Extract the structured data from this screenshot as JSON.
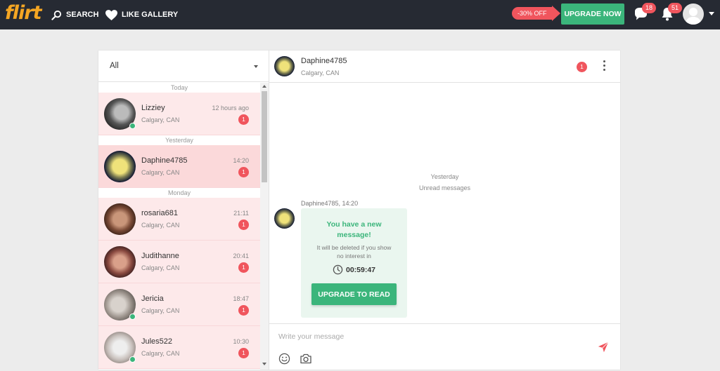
{
  "app": {
    "logo_text": "flirt"
  },
  "nav": {
    "search_label": "SEARCH",
    "like_gallery_label": "LIKE GALLERY"
  },
  "promo": {
    "discount": "-30% OFF",
    "upgrade_label": "UPGRADE NOW"
  },
  "notifications": {
    "messages_count": "18",
    "alerts_count": "51"
  },
  "colors": {
    "accent_green": "#3bb57b",
    "badge_red": "#f0555d",
    "topbar": "#262a33",
    "logo": "#f5a623"
  },
  "filter": {
    "selected": "All"
  },
  "conversations": {
    "sep_today": "Today",
    "sep_yesterday": "Yesterday",
    "sep_monday": "Monday",
    "items": [
      {
        "name": "Lizziey",
        "location": "Calgary, CAN",
        "time": "12 hours ago",
        "unread": "1"
      },
      {
        "name": "Daphine4785",
        "location": "Calgary, CAN",
        "time": "14:20",
        "unread": "1"
      },
      {
        "name": "rosaria681",
        "location": "Calgary, CAN",
        "time": "21:11",
        "unread": "1"
      },
      {
        "name": "Judithanne",
        "location": "Calgary, CAN",
        "time": "20:41",
        "unread": "1"
      },
      {
        "name": "Jericia",
        "location": "Calgary, CAN",
        "time": "18:47",
        "unread": "1"
      },
      {
        "name": "Jules522",
        "location": "Calgary, CAN",
        "time": "10:30",
        "unread": "1"
      }
    ]
  },
  "chat": {
    "name": "Daphine4785",
    "location": "Calgary, CAN",
    "unread": "1",
    "date_sep": "Yesterday",
    "unread_label": "Unread messages",
    "msg_meta": "Daphine4785,  14:20",
    "card_title_line1": "You have a new",
    "card_title_line2": "message!",
    "card_sub_line1": "It will be deleted if you show",
    "card_sub_line2": "no interest in",
    "timer": "00:59:47",
    "upgrade_read_label": "UPGRADE TO READ",
    "input_placeholder": "Write your message"
  }
}
